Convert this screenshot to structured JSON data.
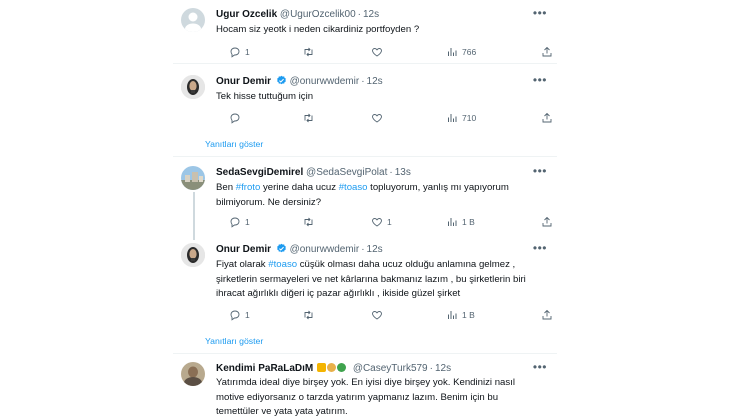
{
  "tweets": [
    {
      "name": "Ugur Ozcelik",
      "handle": "@UgurOzcelik00",
      "time": "12s",
      "text": "Hocam siz yeotk i neden cikardiniz portfoyden ?",
      "replies": "1",
      "retweets": "",
      "likes": "",
      "views": "766",
      "avatar_color": "#cfd9de"
    },
    {
      "name": "Onur Demir",
      "handle": "@onurwwdemir",
      "time": "12s",
      "text": "Tek hisse tuttuğum için",
      "replies": "",
      "retweets": "",
      "likes": "",
      "views": "710",
      "show_replies": "Yanıtları göster",
      "verified": true
    },
    {
      "name": "SedaSevgiDemirel",
      "handle": "@SedaSevgiPolat",
      "time": "13s",
      "text_parts": [
        "Ben ",
        "#froto",
        " yerine daha ucuz ",
        "#toaso",
        " topluyorum, yanlış mı yapıyorum",
        "bilmiyorum. Ne dersiniz?"
      ],
      "replies": "1",
      "retweets": "",
      "likes": "1",
      "views": "1 B"
    },
    {
      "name": "Onur Demir",
      "handle": "@onurwwdemir",
      "time": "12s",
      "text_parts": [
        "Fiyat olarak ",
        "#toaso",
        " cüşük olması daha ucuz olduğu anlamına gelmez ,",
        "şirketlerin sermayeleri ve net kârlarına bakmanız lazım , bu şirketlerin biri",
        "ihracat ağırlıklı diğeri iç pazar ağırlıklı , ikiside güzel şirket"
      ],
      "replies": "1",
      "retweets": "",
      "likes": "",
      "views": "1 B",
      "show_replies": "Yanıtları göster",
      "verified": true
    },
    {
      "name": "Kendimi PaRaLaDıM",
      "handle": "@CaseyTurk579",
      "time": "12s",
      "lines": [
        "Yatırımda ideal diye birşey yok. En iyisi diye birşey yok. Kendinizi nasıl",
        "motive ediyorsanız o tarzda yatırım yapmanız lazım. Benim için bu",
        "temettüler ve yata yata yatırım."
      ]
    }
  ],
  "colors": {
    "accent": "#1d9bf0",
    "muted": "#536471",
    "text": "#0f1419"
  },
  "icons": [
    "reply-icon",
    "retweet-icon",
    "like-icon",
    "views-icon",
    "share-icon",
    "more-icon",
    "verified-icon"
  ]
}
